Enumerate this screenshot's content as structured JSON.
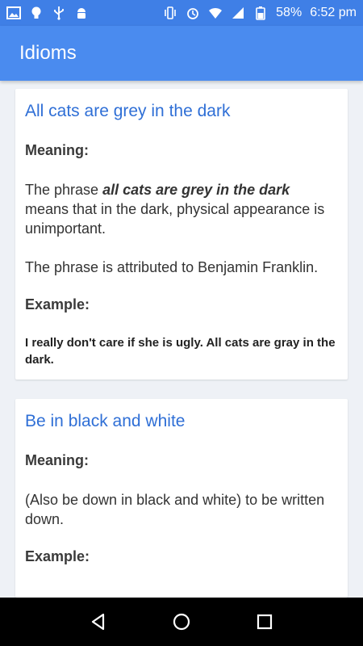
{
  "status_bar": {
    "battery_percent": "58%",
    "time": "6:52 pm",
    "left_icons": [
      "image-icon",
      "bulb-icon",
      "usb-icon",
      "android-icon"
    ],
    "right_icons": [
      "vibrate-icon",
      "alarm-icon",
      "wifi-icon",
      "signal-icon",
      "battery-icon"
    ]
  },
  "app_bar": {
    "title": "Idioms"
  },
  "idioms": [
    {
      "title": "All cats are grey in the dark",
      "meaning_label": "Meaning:",
      "meaning_pre": "The phrase ",
      "meaning_em": "all cats are grey in the dark",
      "meaning_post": " means that in the dark, physical appearance is unimportant.",
      "note": "The phrase is attributed to Benjamin Franklin.",
      "example_label": "Example:",
      "example": "I really don't care if she is ugly. All cats are gray in the dark."
    },
    {
      "title": "Be in black and white",
      "meaning_label": "Meaning:",
      "meaning": "(Also be down in black and white) to be written down.",
      "example_label": "Example:"
    }
  ],
  "nav_bar": {
    "buttons": [
      "back-icon",
      "home-icon",
      "recents-icon"
    ]
  },
  "colors": {
    "status_bar": "#3f7fe6",
    "app_bar": "#4a8bef",
    "title_text": "#2f6fd6",
    "background": "#eef1f6"
  }
}
